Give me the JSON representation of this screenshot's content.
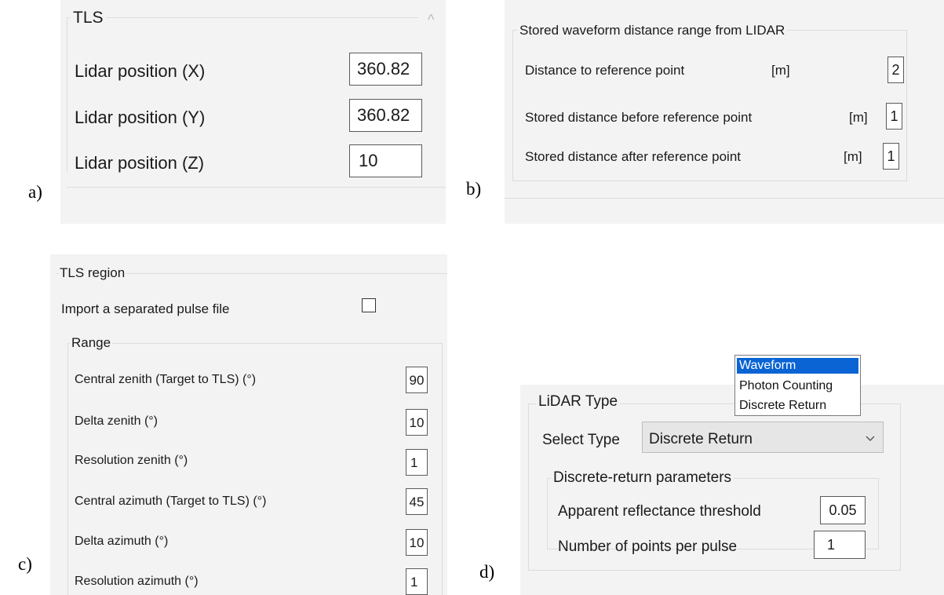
{
  "panel_a": {
    "label": "a)",
    "group_title": "TLS",
    "rows": [
      {
        "label": "Lidar position (X)",
        "value": "360.82"
      },
      {
        "label": "Lidar position (Y)",
        "value": "360.82"
      },
      {
        "label": "Lidar position (Z)",
        "value": "10"
      }
    ],
    "scroll_glyph": "^"
  },
  "panel_b": {
    "label": "b)",
    "group_title": "Stored waveform distance range from LIDAR",
    "rows": [
      {
        "label": "Distance to reference point",
        "unit": "[m]",
        "value": "2"
      },
      {
        "label": "Stored distance before reference point",
        "unit": "[m]",
        "value": "1"
      },
      {
        "label": "Stored distance after reference point",
        "unit": "[m]",
        "value": "1"
      }
    ]
  },
  "panel_c": {
    "label": "c)",
    "group_title": "TLS region",
    "import_label": "Import a separated pulse file",
    "import_checked": false,
    "range_title": "Range",
    "rows": [
      {
        "label": "Central zenith (Target to TLS) (°)",
        "value": "90"
      },
      {
        "label": "Delta zenith (°)",
        "value": "10"
      },
      {
        "label": "Resolution zenith (°)",
        "value": "1"
      },
      {
        "label": "Central azimuth (Target to TLS) (°)",
        "value": "45"
      },
      {
        "label": "Delta azimuth (°)",
        "value": "10"
      },
      {
        "label": "Resolution azimuth (°)",
        "value": "1"
      }
    ]
  },
  "panel_d": {
    "label": "d)",
    "group_title": "LiDAR Type",
    "select_label": "Select Type",
    "select_value": "Discrete Return",
    "dropdown_options": [
      "Waveform",
      "Photon Counting",
      "Discrete Return"
    ],
    "highlighted_option": "Waveform",
    "params_title": "Discrete-return parameters",
    "rows": [
      {
        "label": "Apparent reflectance threshold",
        "value": "0.05"
      },
      {
        "label": "Number of points per pulse",
        "value": "1"
      }
    ]
  },
  "colors": {
    "panel_bg": "#f3f3f3",
    "group_line": "#dcdcdc",
    "field_border": "#5a5a5a",
    "highlight": "#0a64d4"
  }
}
